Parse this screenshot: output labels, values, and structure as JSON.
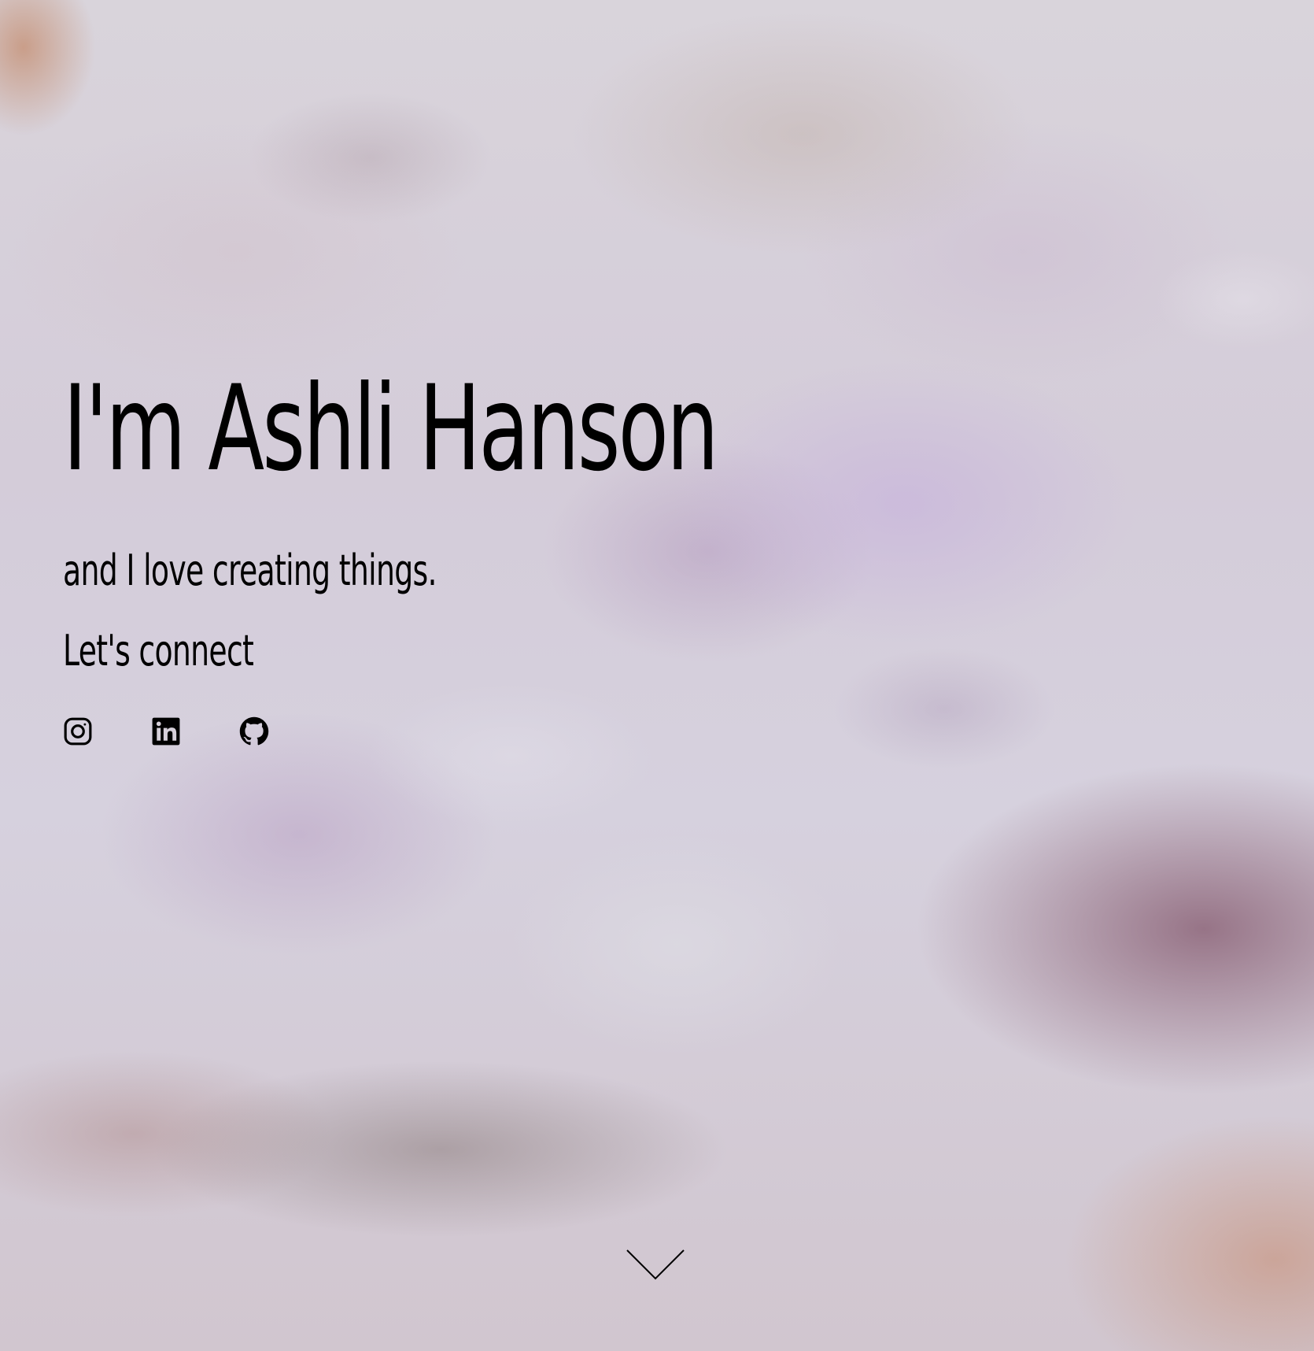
{
  "hero": {
    "title": "I'm Ashli Hanson",
    "subtitle": "and I love creating things.",
    "connect_heading": "Let's connect"
  },
  "social_links": [
    {
      "name": "instagram",
      "icon": "instagram-icon"
    },
    {
      "name": "linkedin",
      "icon": "linkedin-icon"
    },
    {
      "name": "github",
      "icon": "github-icon"
    }
  ],
  "scroll_indicator": {
    "icon": "chevron-down-icon"
  },
  "colors": {
    "text": "#000000",
    "background": "#d7d1dc"
  }
}
